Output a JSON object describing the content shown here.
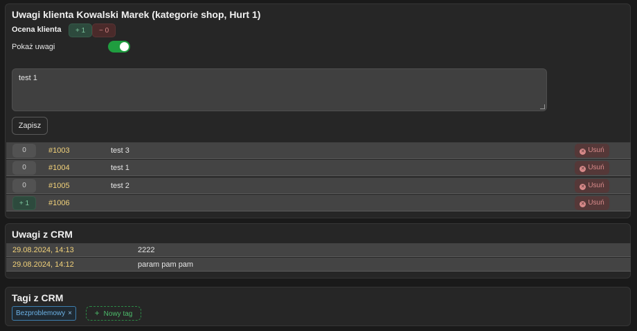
{
  "notes_card": {
    "title": "Uwagi klienta Kowalski Marek (kategorie shop, Hurt 1)",
    "rating_label": "Ocena klienta",
    "rating_plus": "+ 1",
    "rating_minus": "− 0",
    "show_label": "Pokaż uwagi",
    "show_toggle_on": true,
    "note_text": "test 1",
    "save_label": "Zapisz",
    "rows": [
      {
        "count": "0",
        "id": "#1003",
        "text": "test 3",
        "delete_label": "Usuń"
      },
      {
        "count": "0",
        "id": "#1004",
        "text": "test 1",
        "delete_label": "Usuń"
      },
      {
        "count": "0",
        "id": "#1005",
        "text": "test 2",
        "delete_label": "Usuń"
      },
      {
        "count": "+ 1",
        "id": "#1006",
        "text": "",
        "delete_label": "Usuń"
      }
    ]
  },
  "crm_card": {
    "title": "Uwagi z CRM",
    "rows": [
      {
        "date": "29.08.2024, 14:13",
        "text": "2222"
      },
      {
        "date": "29.08.2024, 14:12",
        "text": "param pam pam"
      }
    ]
  },
  "tags_card": {
    "title": "Tagi z CRM",
    "tags": [
      {
        "label": "Bezproblemowy"
      }
    ],
    "remove_icon": "×",
    "new_tag_label": "Nowy tag"
  },
  "colors": {
    "accent_green": "#1f9d3f",
    "id_yellow": "#f2d27a",
    "danger": "#d88a8a",
    "tag_blue": "#6cb2e6"
  },
  "icons": {
    "delete": "x-circle-icon",
    "plus": "plus-icon",
    "remove_tag": "close-icon"
  }
}
